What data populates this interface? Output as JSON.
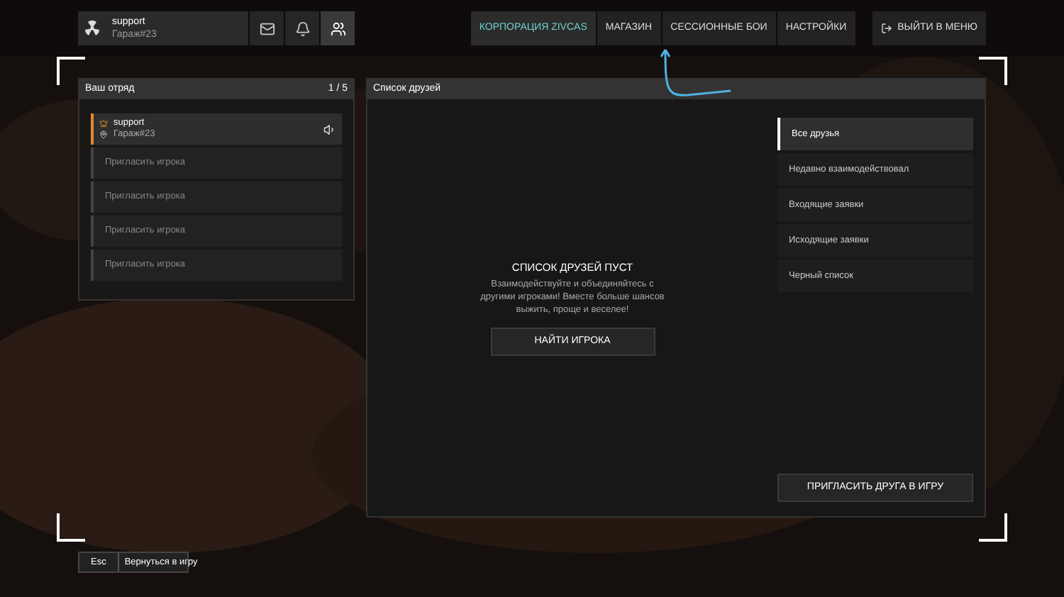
{
  "profile": {
    "name": "support",
    "tag": "Гараж#23"
  },
  "top_icons": [
    {
      "kind": "mail",
      "selected": false
    },
    {
      "kind": "bell",
      "selected": false
    },
    {
      "kind": "friends",
      "selected": true
    }
  ],
  "nav": [
    {
      "label": "КОРПОРАЦИЯ ZIVCAS",
      "selected": true
    },
    {
      "label": "МАГАЗИН",
      "selected": false
    },
    {
      "label": "СЕССИОННЫЕ БОИ",
      "selected": false
    },
    {
      "label": "НАСТРОЙКИ",
      "selected": false
    }
  ],
  "exit_button": "ВЫЙТИ В МЕНЮ",
  "squad": {
    "title": "Ваш отряд",
    "count": "1 / 5",
    "slots": [
      {
        "kind": "member",
        "name": "support",
        "tag": "Гараж#23"
      },
      {
        "kind": "invite",
        "label": "Пригласить игрока"
      },
      {
        "kind": "invite",
        "label": "Пригласить игрока"
      },
      {
        "kind": "invite",
        "label": "Пригласить игрока"
      },
      {
        "kind": "invite",
        "label": "Пригласить игрока"
      }
    ]
  },
  "friends": {
    "title": "Список друзей",
    "empty_title": "СПИСОК ДРУЗЕЙ ПУСТ",
    "empty_text": "Взаимодействуйте и объединяйтесь с другими игроками! Вместе больше шансов выжить, проще и веселее!",
    "find_button": "НАЙТИ ИГРОКА",
    "filters": [
      {
        "label": "Все друзья",
        "selected": true
      },
      {
        "label": "Недавно взаимодействовал",
        "selected": false
      },
      {
        "label": "Входящие заявки",
        "selected": false
      },
      {
        "label": "Исходящие заявки",
        "selected": false
      },
      {
        "label": "Черный список",
        "selected": false
      }
    ],
    "invite_button": "ПРИГЛАСИТЬ ДРУГА В ИГРУ"
  },
  "footer": {
    "key": "Esc",
    "label": "Вернуться в игру"
  }
}
